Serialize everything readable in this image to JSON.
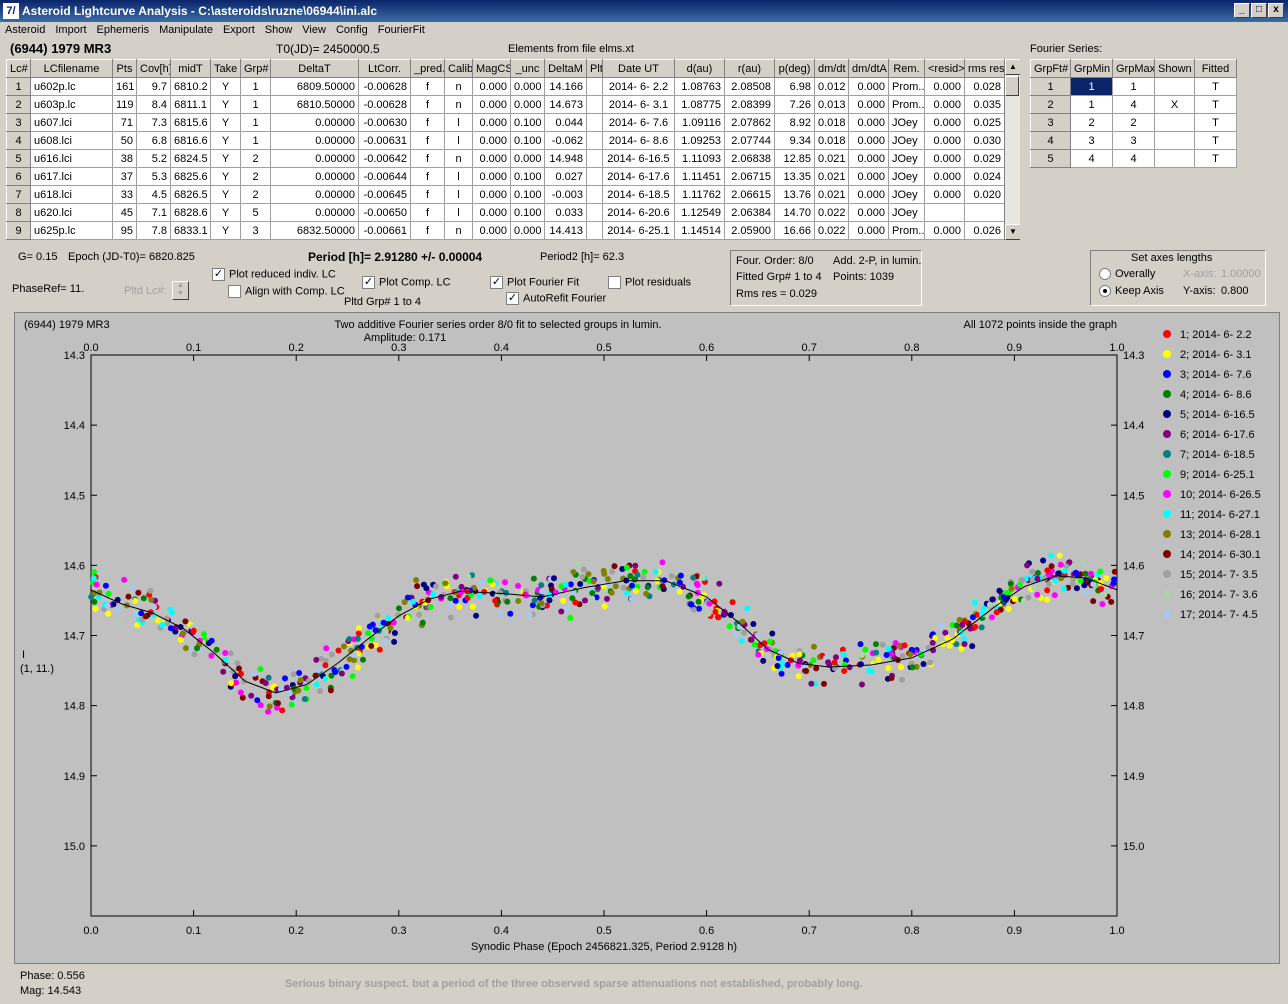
{
  "window": {
    "title": "Asteroid Lightcurve Analysis - C:\\asteroids\\ruzne\\06944\\ini.alc",
    "app_icon": "7/",
    "min": "_",
    "max": "□",
    "close": "x"
  },
  "menu": [
    "Asteroid",
    "Import",
    "Ephemeris",
    "Manipulate",
    "Export",
    "Show",
    "View",
    "Config",
    "FourierFit"
  ],
  "header": {
    "asteroid": "(6944) 1979 MR3",
    "t0": "T0(JD)= 2450000.5",
    "elements": "Elements from file elms.xt",
    "fourier_label": "Fourier Series:"
  },
  "lc_table": {
    "columns": [
      "Lc#",
      "LCfilename",
      "Pts",
      "Cov[h]",
      "midT",
      "Take",
      "Grp#",
      "DeltaT",
      "LtCorr.",
      "_pred.",
      "Calib",
      "MagCS",
      "_unc",
      "DeltaM",
      "Plt",
      "Date UT",
      "d(au)",
      "r(au)",
      "p(deg)",
      "dm/dt",
      "dm/dtA",
      "Rem.",
      "<resid>",
      "rms res"
    ],
    "rows": [
      [
        "1",
        "u602p.lc",
        "161",
        "9.7",
        "6810.2",
        "Y",
        "1",
        "6809.50000",
        "-0.00628",
        "f",
        "n",
        "0.000",
        "0.000",
        "14.166",
        "",
        "2014- 6- 2.2",
        "1.08763",
        "2.08508",
        "6.98",
        "0.012",
        "0.000",
        "Prom...",
        "0.000",
        "0.028"
      ],
      [
        "2",
        "u603p.lc",
        "119",
        "8.4",
        "6811.1",
        "Y",
        "1",
        "6810.50000",
        "-0.00628",
        "f",
        "n",
        "0.000",
        "0.000",
        "14.673",
        "",
        "2014- 6- 3.1",
        "1.08775",
        "2.08399",
        "7.26",
        "0.013",
        "0.000",
        "Prom...",
        "0.000",
        "0.035"
      ],
      [
        "3",
        "u607.lci",
        "71",
        "7.3",
        "6815.6",
        "Y",
        "1",
        "0.00000",
        "-0.00630",
        "f",
        "l",
        "0.000",
        "0.100",
        "0.044",
        "",
        "2014- 6- 7.6",
        "1.09116",
        "2.07862",
        "8.92",
        "0.018",
        "0.000",
        "JOey",
        "0.000",
        "0.025"
      ],
      [
        "4",
        "u608.lci",
        "50",
        "6.8",
        "6816.6",
        "Y",
        "1",
        "0.00000",
        "-0.00631",
        "f",
        "l",
        "0.000",
        "0.100",
        "-0.062",
        "",
        "2014- 6- 8.6",
        "1.09253",
        "2.07744",
        "9.34",
        "0.018",
        "0.000",
        "JOey",
        "0.000",
        "0.030"
      ],
      [
        "5",
        "u616.lci",
        "38",
        "5.2",
        "6824.5",
        "Y",
        "2",
        "0.00000",
        "-0.00642",
        "f",
        "n",
        "0.000",
        "0.000",
        "14.948",
        "",
        "2014- 6-16.5",
        "1.11093",
        "2.06838",
        "12.85",
        "0.021",
        "0.000",
        "JOey",
        "0.000",
        "0.029"
      ],
      [
        "6",
        "u617.lci",
        "37",
        "5.3",
        "6825.6",
        "Y",
        "2",
        "0.00000",
        "-0.00644",
        "f",
        "l",
        "0.000",
        "0.100",
        "0.027",
        "",
        "2014- 6-17.6",
        "1.11451",
        "2.06715",
        "13.35",
        "0.021",
        "0.000",
        "JOey",
        "0.000",
        "0.024"
      ],
      [
        "7",
        "u618.lci",
        "33",
        "4.5",
        "6826.5",
        "Y",
        "2",
        "0.00000",
        "-0.00645",
        "f",
        "l",
        "0.000",
        "0.100",
        "-0.003",
        "",
        "2014- 6-18.5",
        "1.11762",
        "2.06615",
        "13.76",
        "0.021",
        "0.000",
        "JOey",
        "0.000",
        "0.020"
      ],
      [
        "8",
        "u620.lci",
        "45",
        "7.1",
        "6828.6",
        "Y",
        "5",
        "0.00000",
        "-0.00650",
        "f",
        "l",
        "0.000",
        "0.100",
        "0.033",
        "",
        "2014- 6-20.6",
        "1.12549",
        "2.06384",
        "14.70",
        "0.022",
        "0.000",
        "JOey",
        "",
        ""
      ],
      [
        "9",
        "u625p.lc",
        "95",
        "7.8",
        "6833.1",
        "Y",
        "3",
        "6832.50000",
        "-0.00661",
        "f",
        "n",
        "0.000",
        "0.000",
        "14.413",
        "",
        "2014- 6-25.1",
        "1.14514",
        "2.05900",
        "16.66",
        "0.022",
        "0.000",
        "Prom...",
        "0.000",
        "0.026"
      ]
    ]
  },
  "fourier_table": {
    "columns": [
      "GrpFt#",
      "GrpMin",
      "GrpMax",
      "Shown",
      "Fitted"
    ],
    "rows": [
      [
        "1",
        "1",
        "1",
        "",
        "T"
      ],
      [
        "2",
        "1",
        "4",
        "X",
        "T"
      ],
      [
        "3",
        "2",
        "2",
        "",
        "T"
      ],
      [
        "4",
        "3",
        "3",
        "",
        "T"
      ],
      [
        "5",
        "4",
        "4",
        "",
        "T"
      ]
    ]
  },
  "controls": {
    "g": "G= 0.15",
    "epoch": "Epoch (JD-T0)= 6820.825",
    "period": "Period [h]= 2.91280 +/- 0.00004",
    "period2": "Period2 [h]= 62.3",
    "phaseref": "PhaseRef= 11.",
    "pltd_lc": "Pltd Lc#:",
    "plot_reduced": "Plot reduced indiv. LC",
    "align_comp": "Align with Comp. LC",
    "plot_comp": "Plot Comp. LC",
    "pltd_grp": "Pltd Grp#  1   to   4",
    "plot_fourier": "Plot Fourier Fit",
    "autorefit": "AutoRefit Fourier",
    "plot_resid": "Plot residuals",
    "fit_info": {
      "order": "Four. Order:  8/0",
      "addp": "Add. 2-P, in lumin.",
      "fitted": "Fitted Grp# 1 to 4",
      "points": "Points: 1039",
      "rms": "Rms res    = 0.029"
    },
    "axes": {
      "title": "Set axes lengths",
      "overall": "Overally",
      "keep": "Keep Axis",
      "xlabel": "X-axis:",
      "xval": "1.00000",
      "ylabel": "Y-axis:",
      "yval": "0.800"
    }
  },
  "chart_data": {
    "type": "scatter",
    "title": "Two additive Fourier series order 8/0 fit to selected groups in lumin.",
    "subtitle": "Amplitude: 0.171",
    "corner_left": "(6944) 1979 MR3",
    "corner_right": "All 1072 points inside the graph",
    "xlabel": "Synodic Phase (Epoch 2456821.325, Period 2.9128 h)",
    "ylabel": "I",
    "ylabel2": "(1, 11.)",
    "xlim": [
      0.0,
      1.0
    ],
    "ylim": [
      14.3,
      15.1
    ],
    "y_inverted": true,
    "x_ticks": [
      "0.0",
      "0.1",
      "0.2",
      "0.3",
      "0.4",
      "0.5",
      "0.6",
      "0.7",
      "0.8",
      "0.9",
      "1.0"
    ],
    "y_ticks": [
      "14.3",
      "14.4",
      "14.5",
      "14.6",
      "14.7",
      "14.8",
      "14.9",
      "15.0"
    ],
    "fit_curve": {
      "x": [
        0.0,
        0.03,
        0.06,
        0.09,
        0.12,
        0.15,
        0.18,
        0.21,
        0.24,
        0.27,
        0.3,
        0.33,
        0.36,
        0.4,
        0.44,
        0.48,
        0.52,
        0.56,
        0.6,
        0.63,
        0.66,
        0.69,
        0.72,
        0.76,
        0.8,
        0.84,
        0.88,
        0.91,
        0.94,
        0.97,
        1.0
      ],
      "y": [
        14.635,
        14.655,
        14.668,
        14.69,
        14.725,
        14.765,
        14.782,
        14.77,
        14.74,
        14.705,
        14.672,
        14.648,
        14.637,
        14.64,
        14.645,
        14.632,
        14.622,
        14.622,
        14.645,
        14.68,
        14.72,
        14.74,
        14.745,
        14.742,
        14.732,
        14.705,
        14.66,
        14.63,
        14.615,
        14.618,
        14.635
      ]
    },
    "series": [
      {
        "name": "1; 2014- 6- 2.2",
        "color": "#ff0000"
      },
      {
        "name": "2; 2014- 6- 3.1",
        "color": "#ffff00"
      },
      {
        "name": "3; 2014- 6- 7.6",
        "color": "#0000ff"
      },
      {
        "name": "4; 2014- 6- 8.6",
        "color": "#008000"
      },
      {
        "name": "5; 2014- 6-16.5",
        "color": "#000080"
      },
      {
        "name": "6; 2014- 6-17.6",
        "color": "#800080"
      },
      {
        "name": "7; 2014- 6-18.5",
        "color": "#008080"
      },
      {
        "name": "9; 2014- 6-25.1",
        "color": "#00ff00"
      },
      {
        "name": "10; 2014- 6-26.5",
        "color": "#ff00ff"
      },
      {
        "name": "11; 2014- 6-27.1",
        "color": "#00ffff"
      },
      {
        "name": "13; 2014- 6-28.1",
        "color": "#808000"
      },
      {
        "name": "14; 2014- 6-30.1",
        "color": "#800000"
      },
      {
        "name": "15; 2014- 7- 3.5",
        "color": "#a0a0a0"
      },
      {
        "name": "16; 2014- 7- 3.6",
        "color": "#b0d0b0"
      },
      {
        "name": "17; 2014- 7- 4.5",
        "color": "#a8c8f0"
      }
    ]
  },
  "status": {
    "phase": "Phase:  0.556",
    "mag": "Mag:    14.543",
    "note": "Serious binary suspect. but a period of the three observed sparse attenuations not established, probably long."
  }
}
